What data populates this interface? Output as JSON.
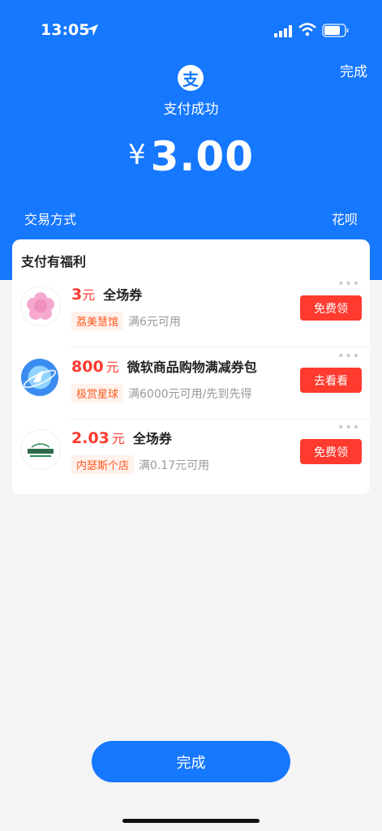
{
  "status_bar": {
    "time": "13:05"
  },
  "header": {
    "done_label": "完成",
    "logo_glyph": "支",
    "success_text": "支付成功",
    "currency": "¥",
    "amount": "3.00",
    "tx_label": "交易方式",
    "tx_value": "花呗"
  },
  "benefits": {
    "title": "支付有福利",
    "offers": [
      {
        "amount": "3",
        "unit": "元",
        "desc": "全场券",
        "shop": "荔美慧馆",
        "cond": "满6元可用",
        "button": "免费领"
      },
      {
        "amount": "800",
        "unit": "元",
        "desc": "微软商品购物满减券包",
        "shop": "极赏星球",
        "cond": "满6000元可用/先到先得",
        "button": "去看看"
      },
      {
        "amount": "2.03",
        "unit": "元",
        "desc": "全场券",
        "shop": "内瑟斯个店",
        "cond": "满0.17元可用",
        "button": "免费领"
      }
    ]
  },
  "footer": {
    "done_label": "完成"
  },
  "colors": {
    "brand": "#1677ff",
    "accent": "#ff3a2f"
  },
  "icons": [
    "location-arrow-icon",
    "signal-icon",
    "wifi-icon",
    "battery-icon",
    "alipay-logo-icon",
    "more-dots-icon"
  ]
}
